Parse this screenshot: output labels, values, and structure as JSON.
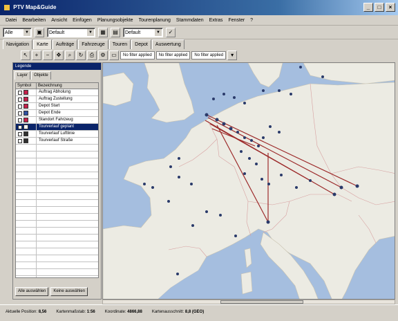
{
  "window": {
    "title": "PTV Map&Guide"
  },
  "menu": [
    "Datei",
    "Bearbeiten",
    "Ansicht",
    "Einfügen",
    "Planungsobjekte",
    "Tourenplanung",
    "Stammdaten",
    "Extras",
    "Fenster",
    "?"
  ],
  "toolbar": {
    "combo1": "Alle",
    "combo2": "Default",
    "combo3": "Default"
  },
  "main_tabs": [
    "Navigation",
    "Karte",
    "Aufträge",
    "Fahrzeuge",
    "Touren",
    "Depot",
    "Auswertung"
  ],
  "filters": [
    "No filter applied",
    "No filter applied",
    "No filter applied"
  ],
  "left_panel": {
    "title": "Legende",
    "tabs": [
      "Layer",
      "Objekte"
    ],
    "columns": [
      "Symbol",
      "Bezeichnung"
    ],
    "rows": [
      {
        "label": "Auftrag Abholung",
        "color": "#c4204a",
        "selected": false
      },
      {
        "label": "Auftrag Zustellung",
        "color": "#c4204a",
        "selected": false
      },
      {
        "label": "Depot Start",
        "color": "#c4204a",
        "selected": false
      },
      {
        "label": "Depot Ende",
        "color": "#3050a0",
        "selected": false
      },
      {
        "label": "Standort Fahrzeug",
        "color": "#c4204a",
        "selected": false
      },
      {
        "label": "Tourverlauf geplant",
        "color": "#ffffff",
        "selected": true
      },
      {
        "label": "Tourverlauf Luftlinie",
        "color": "#303030",
        "selected": false
      },
      {
        "label": "Tourverlauf Straße",
        "color": "#303030",
        "selected": false
      }
    ],
    "buttons": [
      "Alle auswählen",
      "Keine auswählen"
    ]
  },
  "status": [
    {
      "label": "Aktuelle Position:",
      "value": "8,56"
    },
    {
      "label": "Kartenmaßstab:",
      "value": "1:56"
    },
    {
      "label": "Koordinate:",
      "value": "4866,88"
    },
    {
      "label": "Kartenausschnitt:",
      "value": "8,8 (GEO)"
    }
  ],
  "colors": {
    "sea": "#a5bedf",
    "land": "#ecebe3",
    "route": "#9c2a2a",
    "marker": "#2a3a6a"
  }
}
